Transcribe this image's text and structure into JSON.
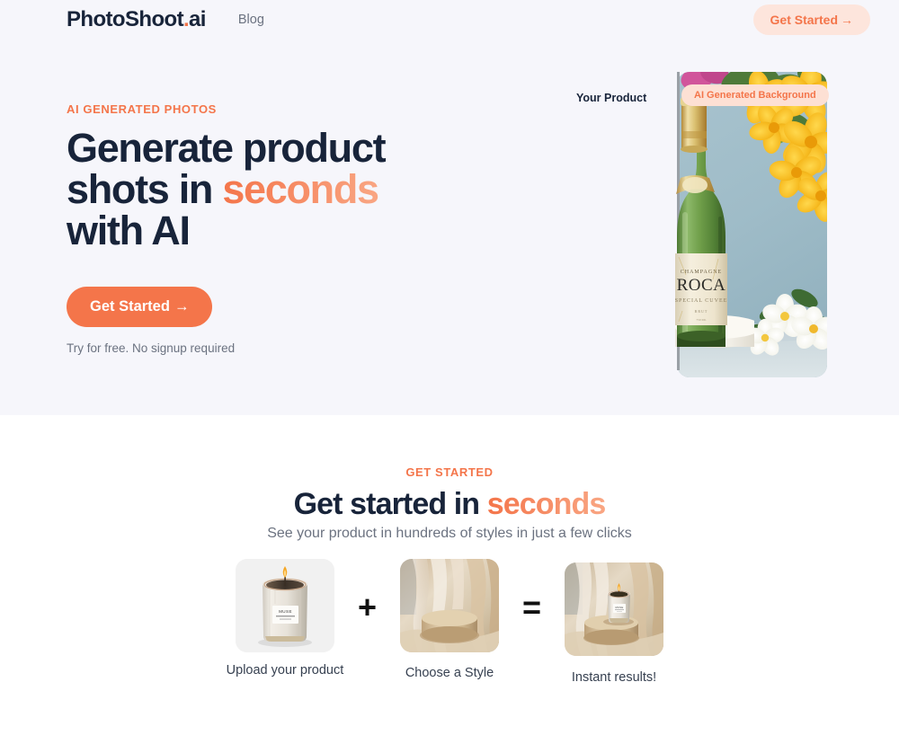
{
  "nav": {
    "brand_main": "PhotoShoot",
    "brand_dot": ".",
    "brand_suffix": "ai",
    "links": [
      {
        "label": "Blog"
      }
    ],
    "cta_label": "Get Started",
    "cta_arrow": "→"
  },
  "hero": {
    "eyebrow": "AI GENERATED PHOTOS",
    "title_part1": "Generate product shots in ",
    "title_highlight": "seconds",
    "title_part2": " with AI",
    "cta_label": "Get Started",
    "cta_arrow": "→",
    "note": "Try for free. No signup required",
    "product_label": "Your Product",
    "background_badge": "AI Generated Background",
    "bottle_brand": "ROCA",
    "bottle_top_text": "CHAMPAGNE",
    "bottle_sub_text": "SPECIAL CUVEE"
  },
  "get_started": {
    "eyebrow": "GET STARTED",
    "title_part1": "Get started in ",
    "title_highlight": "seconds",
    "subtitle": "See your product in hundreds of styles in just a few clicks",
    "operator_plus": "+",
    "operator_equals": "=",
    "steps": [
      {
        "caption": "Upload your product",
        "icon": "candle-product-image"
      },
      {
        "caption": "Choose a Style",
        "icon": "style-podium-image"
      },
      {
        "caption": "Instant results!",
        "icon": "result-composite-image"
      }
    ]
  },
  "colors": {
    "accent": "#F4754A",
    "accent_light": "#F9A683",
    "accent_bg": "#FDE5DC",
    "ink": "#18243A",
    "muted": "#6B7280",
    "hero_bg": "#F6F6FB",
    "page_bg": "#FFFFFF"
  }
}
